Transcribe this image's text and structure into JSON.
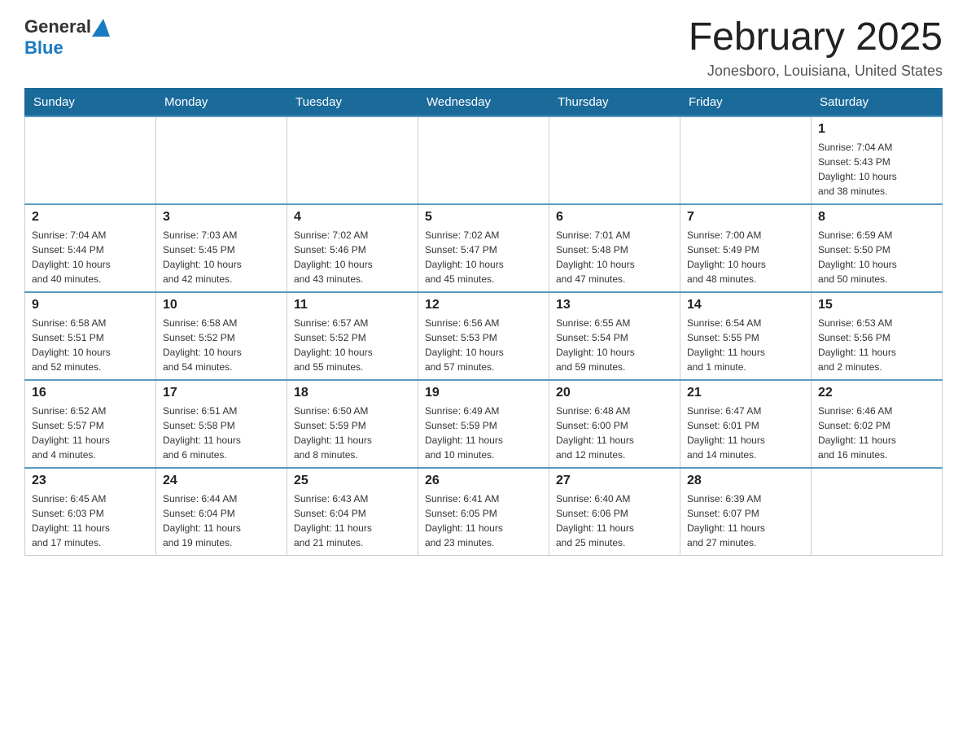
{
  "header": {
    "logo_general": "General",
    "logo_blue": "Blue",
    "month_title": "February 2025",
    "location": "Jonesboro, Louisiana, United States"
  },
  "days_of_week": [
    "Sunday",
    "Monday",
    "Tuesday",
    "Wednesday",
    "Thursday",
    "Friday",
    "Saturday"
  ],
  "weeks": [
    [
      {
        "day": "",
        "info": ""
      },
      {
        "day": "",
        "info": ""
      },
      {
        "day": "",
        "info": ""
      },
      {
        "day": "",
        "info": ""
      },
      {
        "day": "",
        "info": ""
      },
      {
        "day": "",
        "info": ""
      },
      {
        "day": "1",
        "info": "Sunrise: 7:04 AM\nSunset: 5:43 PM\nDaylight: 10 hours\nand 38 minutes."
      }
    ],
    [
      {
        "day": "2",
        "info": "Sunrise: 7:04 AM\nSunset: 5:44 PM\nDaylight: 10 hours\nand 40 minutes."
      },
      {
        "day": "3",
        "info": "Sunrise: 7:03 AM\nSunset: 5:45 PM\nDaylight: 10 hours\nand 42 minutes."
      },
      {
        "day": "4",
        "info": "Sunrise: 7:02 AM\nSunset: 5:46 PM\nDaylight: 10 hours\nand 43 minutes."
      },
      {
        "day": "5",
        "info": "Sunrise: 7:02 AM\nSunset: 5:47 PM\nDaylight: 10 hours\nand 45 minutes."
      },
      {
        "day": "6",
        "info": "Sunrise: 7:01 AM\nSunset: 5:48 PM\nDaylight: 10 hours\nand 47 minutes."
      },
      {
        "day": "7",
        "info": "Sunrise: 7:00 AM\nSunset: 5:49 PM\nDaylight: 10 hours\nand 48 minutes."
      },
      {
        "day": "8",
        "info": "Sunrise: 6:59 AM\nSunset: 5:50 PM\nDaylight: 10 hours\nand 50 minutes."
      }
    ],
    [
      {
        "day": "9",
        "info": "Sunrise: 6:58 AM\nSunset: 5:51 PM\nDaylight: 10 hours\nand 52 minutes."
      },
      {
        "day": "10",
        "info": "Sunrise: 6:58 AM\nSunset: 5:52 PM\nDaylight: 10 hours\nand 54 minutes."
      },
      {
        "day": "11",
        "info": "Sunrise: 6:57 AM\nSunset: 5:52 PM\nDaylight: 10 hours\nand 55 minutes."
      },
      {
        "day": "12",
        "info": "Sunrise: 6:56 AM\nSunset: 5:53 PM\nDaylight: 10 hours\nand 57 minutes."
      },
      {
        "day": "13",
        "info": "Sunrise: 6:55 AM\nSunset: 5:54 PM\nDaylight: 10 hours\nand 59 minutes."
      },
      {
        "day": "14",
        "info": "Sunrise: 6:54 AM\nSunset: 5:55 PM\nDaylight: 11 hours\nand 1 minute."
      },
      {
        "day": "15",
        "info": "Sunrise: 6:53 AM\nSunset: 5:56 PM\nDaylight: 11 hours\nand 2 minutes."
      }
    ],
    [
      {
        "day": "16",
        "info": "Sunrise: 6:52 AM\nSunset: 5:57 PM\nDaylight: 11 hours\nand 4 minutes."
      },
      {
        "day": "17",
        "info": "Sunrise: 6:51 AM\nSunset: 5:58 PM\nDaylight: 11 hours\nand 6 minutes."
      },
      {
        "day": "18",
        "info": "Sunrise: 6:50 AM\nSunset: 5:59 PM\nDaylight: 11 hours\nand 8 minutes."
      },
      {
        "day": "19",
        "info": "Sunrise: 6:49 AM\nSunset: 5:59 PM\nDaylight: 11 hours\nand 10 minutes."
      },
      {
        "day": "20",
        "info": "Sunrise: 6:48 AM\nSunset: 6:00 PM\nDaylight: 11 hours\nand 12 minutes."
      },
      {
        "day": "21",
        "info": "Sunrise: 6:47 AM\nSunset: 6:01 PM\nDaylight: 11 hours\nand 14 minutes."
      },
      {
        "day": "22",
        "info": "Sunrise: 6:46 AM\nSunset: 6:02 PM\nDaylight: 11 hours\nand 16 minutes."
      }
    ],
    [
      {
        "day": "23",
        "info": "Sunrise: 6:45 AM\nSunset: 6:03 PM\nDaylight: 11 hours\nand 17 minutes."
      },
      {
        "day": "24",
        "info": "Sunrise: 6:44 AM\nSunset: 6:04 PM\nDaylight: 11 hours\nand 19 minutes."
      },
      {
        "day": "25",
        "info": "Sunrise: 6:43 AM\nSunset: 6:04 PM\nDaylight: 11 hours\nand 21 minutes."
      },
      {
        "day": "26",
        "info": "Sunrise: 6:41 AM\nSunset: 6:05 PM\nDaylight: 11 hours\nand 23 minutes."
      },
      {
        "day": "27",
        "info": "Sunrise: 6:40 AM\nSunset: 6:06 PM\nDaylight: 11 hours\nand 25 minutes."
      },
      {
        "day": "28",
        "info": "Sunrise: 6:39 AM\nSunset: 6:07 PM\nDaylight: 11 hours\nand 27 minutes."
      },
      {
        "day": "",
        "info": ""
      }
    ]
  ]
}
